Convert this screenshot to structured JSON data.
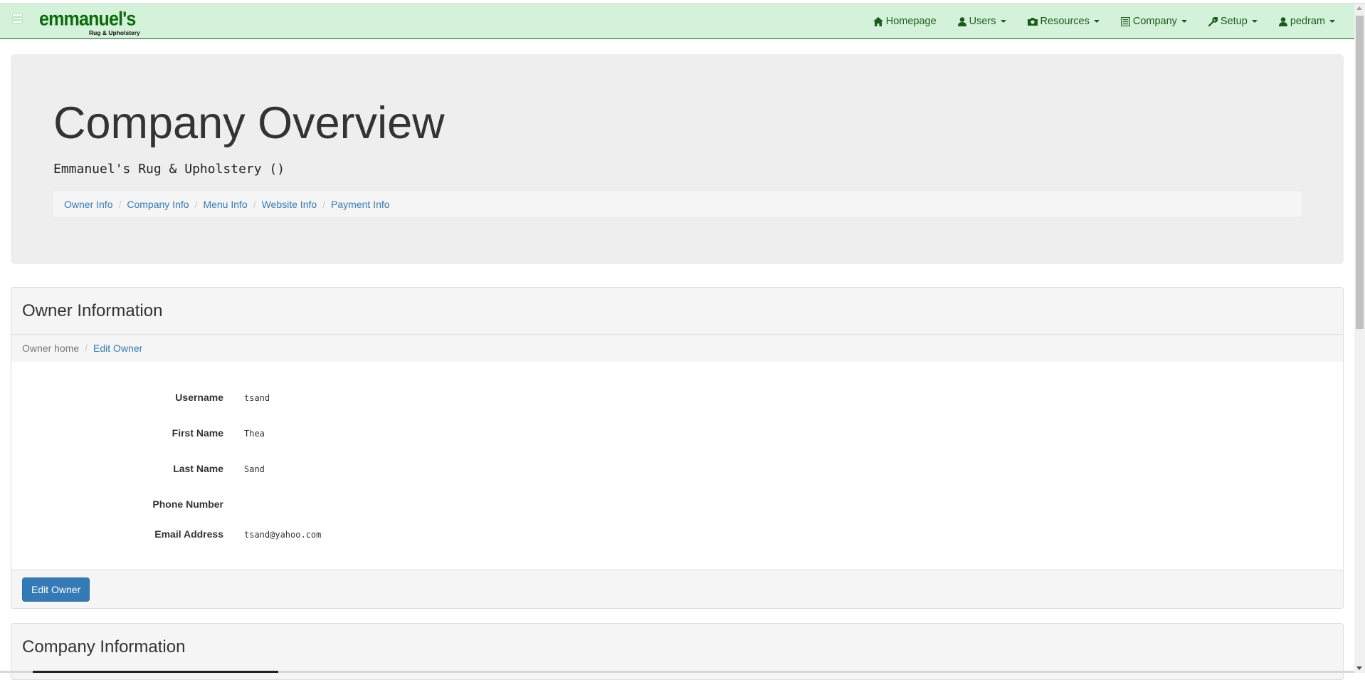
{
  "brand": {
    "name": "emmanuel's",
    "tagline": "Rug & Upholstery"
  },
  "nav": [
    {
      "label": "Homepage",
      "icon": "home-icon",
      "dropdown": false
    },
    {
      "label": "Users",
      "icon": "user-icon",
      "dropdown": true
    },
    {
      "label": "Resources",
      "icon": "camera-icon",
      "dropdown": true
    },
    {
      "label": "Company",
      "icon": "list-alt-icon",
      "dropdown": true
    },
    {
      "label": "Setup",
      "icon": "wrench-icon",
      "dropdown": true
    },
    {
      "label": "pedram",
      "icon": "user-icon",
      "dropdown": true
    }
  ],
  "header": {
    "title": "Company Overview",
    "subtitle": "Emmanuel's Rug & Upholstery ()",
    "breadcrumb": [
      "Owner Info",
      "Company Info",
      "Menu Info",
      "Website Info",
      "Payment Info"
    ]
  },
  "owner_panel": {
    "title": "Owner Information",
    "breadcrumb": {
      "active": "Owner home",
      "link": "Edit Owner"
    },
    "fields": [
      {
        "label": "Username",
        "value": "tsand"
      },
      {
        "label": "First Name",
        "value": "Thea"
      },
      {
        "label": "Last Name",
        "value": "Sand"
      },
      {
        "label": "Phone Number",
        "value": ""
      },
      {
        "label": "Email Address",
        "value": "tsand@yahoo.com"
      }
    ],
    "button": "Edit Owner"
  },
  "company_panel": {
    "title": "Company Information"
  },
  "colors": {
    "navbar_bg": "#d4f1d9",
    "brand": "#0b6b0b",
    "link": "#337ab7",
    "button": "#337ab7"
  }
}
